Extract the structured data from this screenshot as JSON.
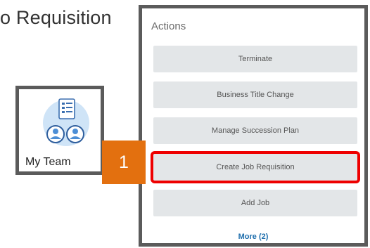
{
  "page": {
    "title": "o Requisition"
  },
  "tile": {
    "label": "My Team",
    "icon": "team-people-icon"
  },
  "step": {
    "number": "1",
    "color": "#e3700f"
  },
  "actions": {
    "title": "Actions",
    "buttons": [
      {
        "label": "Terminate"
      },
      {
        "label": "Business Title Change"
      },
      {
        "label": "Manage Succession Plan"
      },
      {
        "label": "Create Job Requisition",
        "selected": true
      },
      {
        "label": "Add Job"
      }
    ],
    "more_label": "More (2)"
  },
  "colors": {
    "highlight": "#ee0000",
    "button_bg": "#e3e6e8",
    "link": "#1f6fad",
    "frame": "#5b5b5b"
  }
}
